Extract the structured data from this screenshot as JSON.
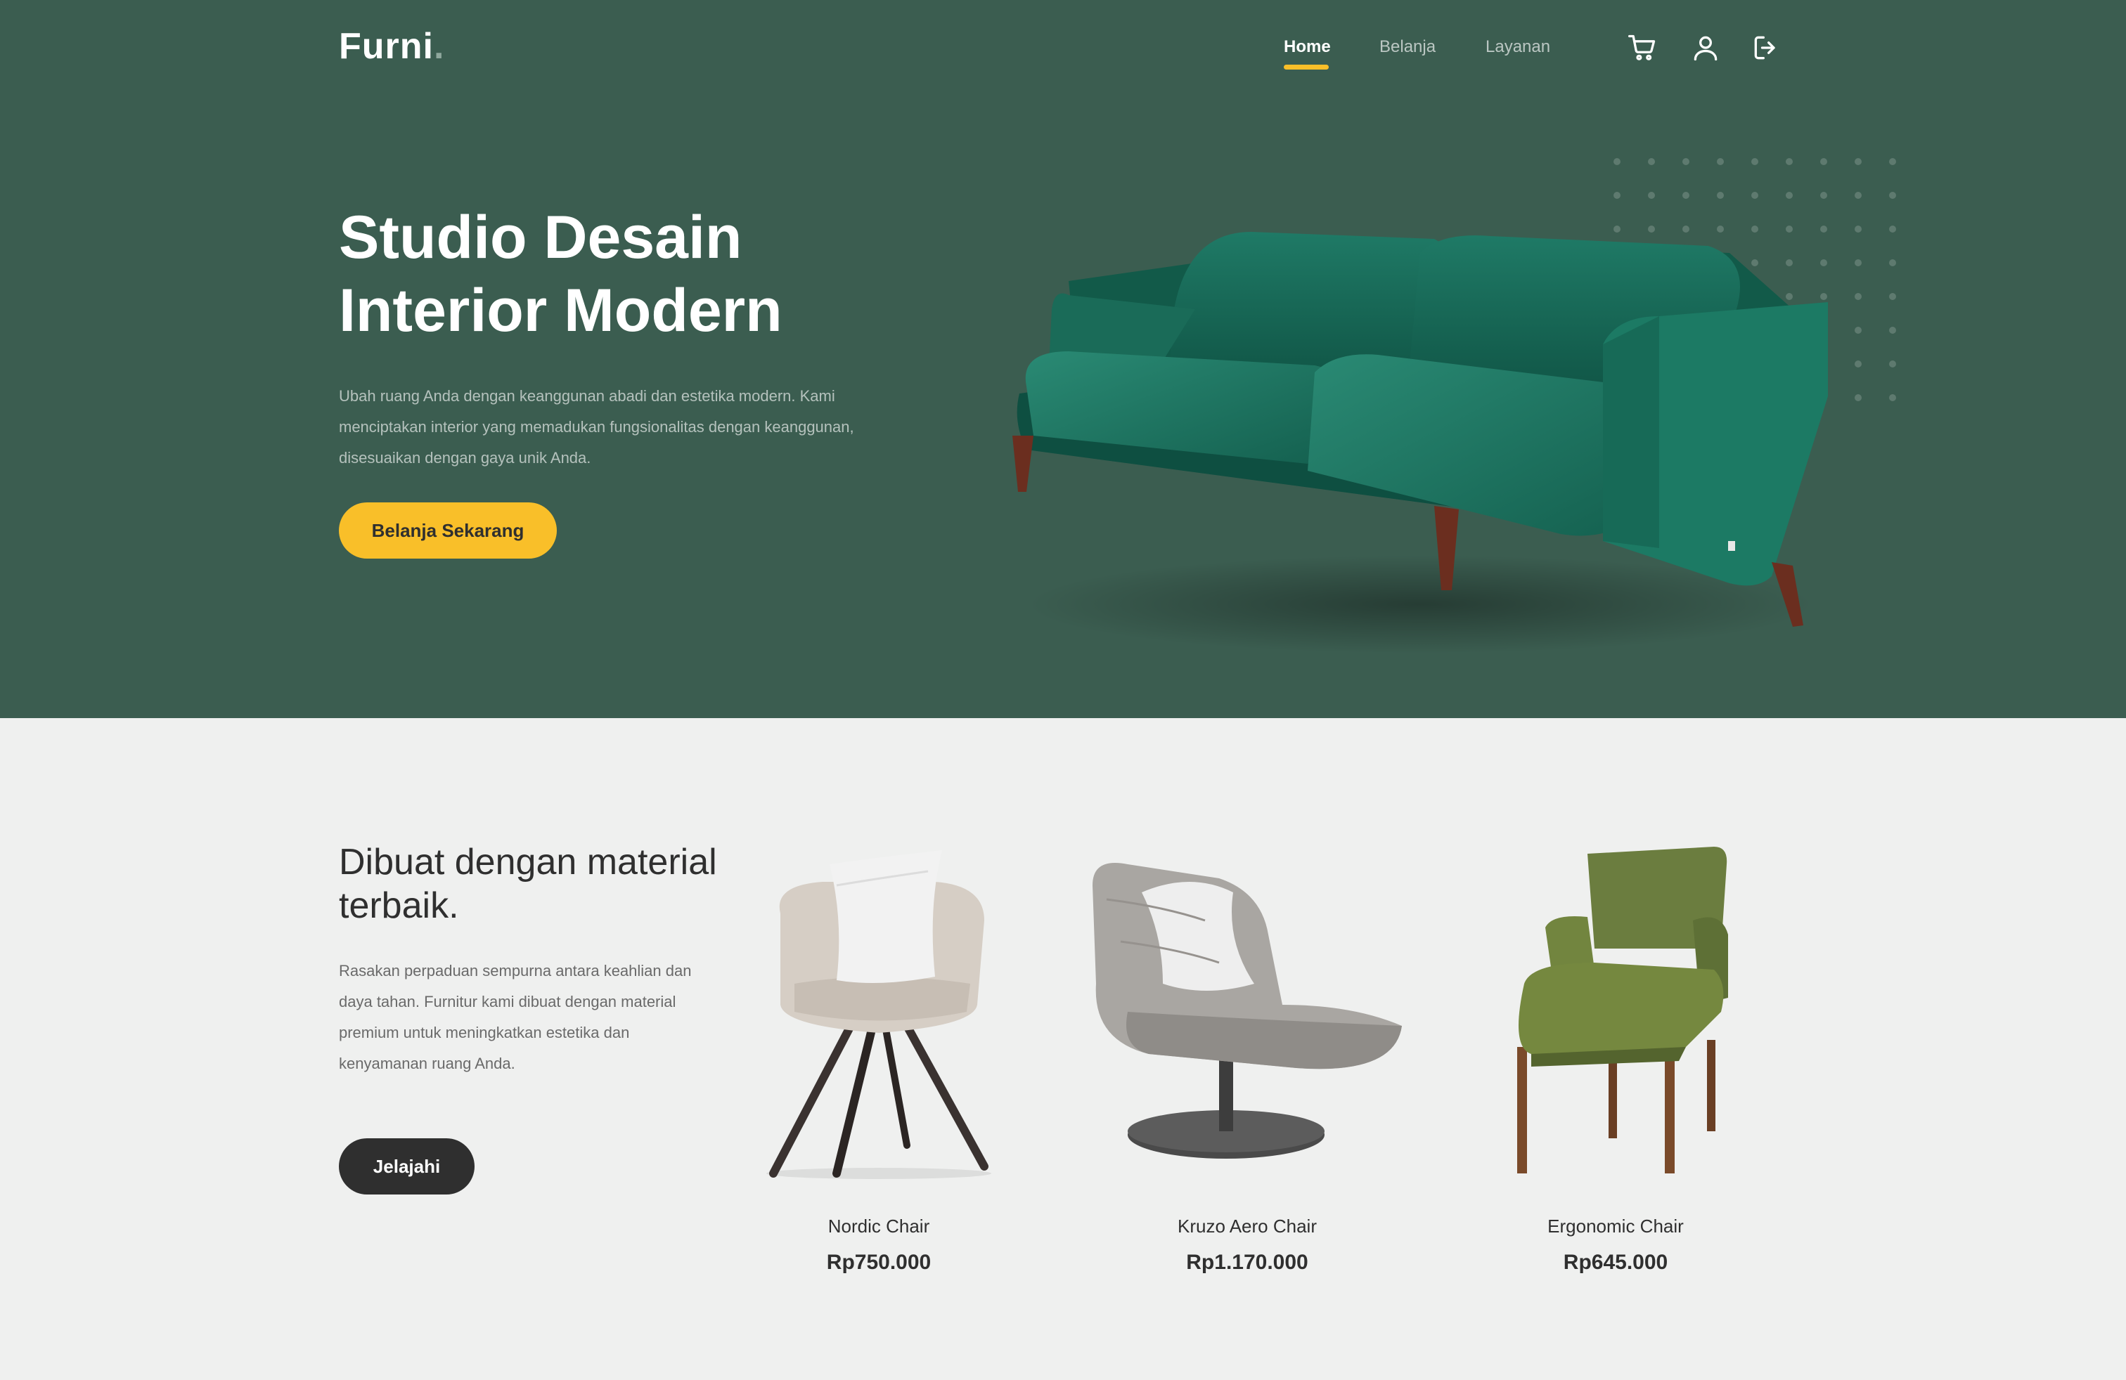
{
  "nav": {
    "logo": "Furni",
    "logo_dot": ".",
    "links": [
      "Home",
      "Belanja",
      "Layanan"
    ],
    "active_link": "Home",
    "icons": [
      "cart-icon",
      "user-icon",
      "logout-icon"
    ]
  },
  "hero": {
    "title_line1": "Studio Desain",
    "title_line2": "Interior Modern",
    "description": "Ubah ruang Anda dengan keanggunan abadi dan estetika modern. Kami menciptakan interior yang memadukan fungsionalitas dengan keanggunan, disesuaikan dengan gaya unik Anda.",
    "cta_label": "Belanja Sekarang",
    "image": "green-velvet-sofa"
  },
  "materials": {
    "title": "Dibuat dengan material terbaik.",
    "description": "Rasakan perpaduan sempurna antara keahlian dan daya tahan. Furnitur kami dibuat dengan material premium untuk meningkatkan estetika dan kenyamanan ruang Anda.",
    "cta_label": "Jelajahi"
  },
  "products": [
    {
      "name": "Nordic Chair",
      "price": "Rp750.000",
      "image": "nordic-chair"
    },
    {
      "name": "Kruzo Aero Chair",
      "price": "Rp1.170.000",
      "image": "kruzo-aero-chair"
    },
    {
      "name": "Ergonomic Chair",
      "price": "Rp645.000",
      "image": "ergonomic-chair"
    }
  ],
  "colors": {
    "hero_bg": "#3b5d50",
    "accent": "#f9bf29",
    "page_bg": "#eff0ef",
    "dark": "#2f2f2f"
  }
}
